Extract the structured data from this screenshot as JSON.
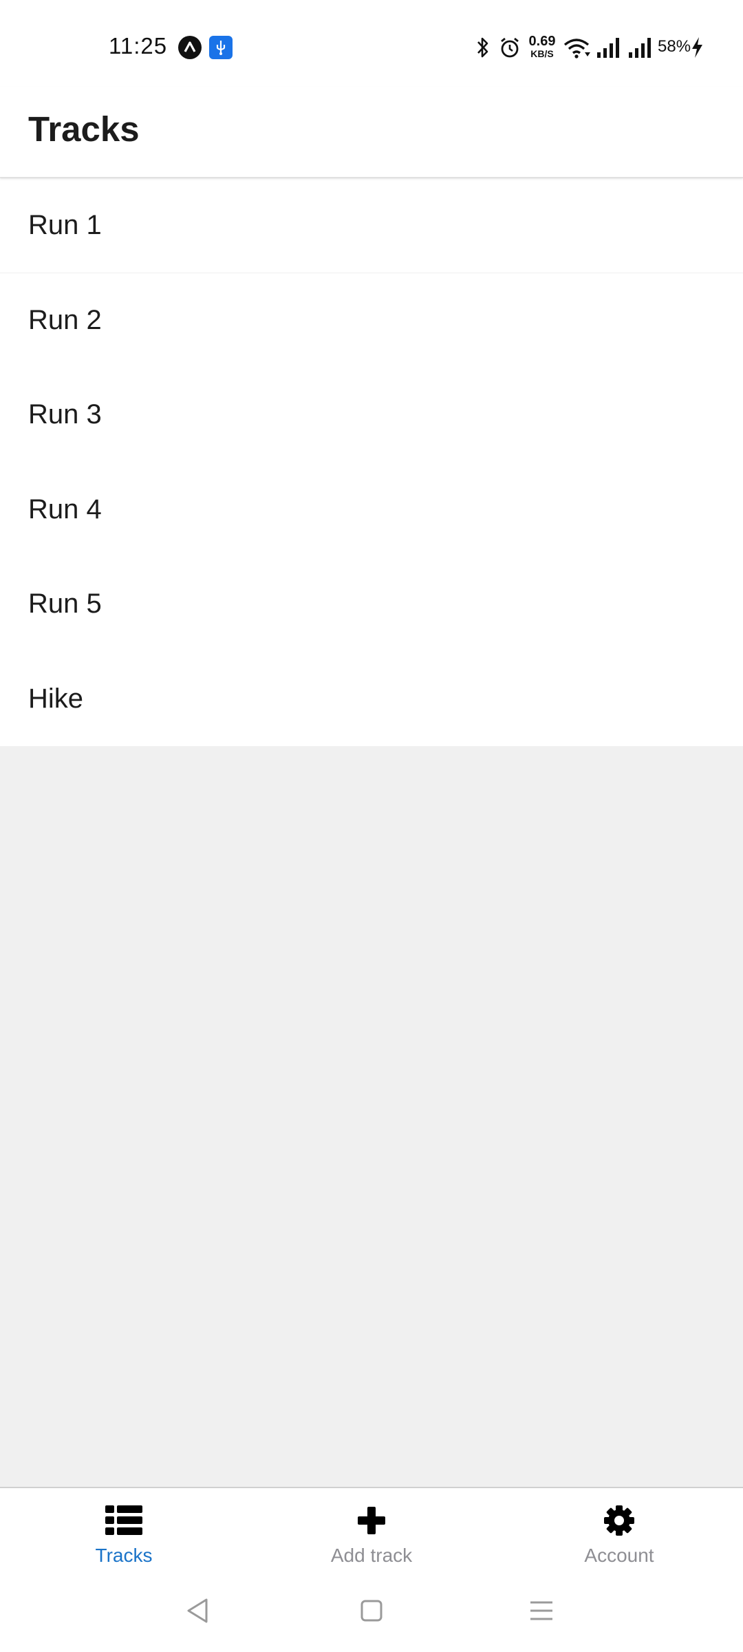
{
  "status_bar": {
    "time": "11:25",
    "net_speed_value": "0.69",
    "net_speed_unit": "KB/S",
    "battery": "58%",
    "icons": [
      "app-notification-icon",
      "usb-debug-icon",
      "bluetooth-icon",
      "alarm-icon",
      "wifi-icon",
      "signal-icon",
      "signal-icon",
      "charging-icon"
    ]
  },
  "header": {
    "title": "Tracks"
  },
  "tracks": [
    {
      "label": "Run 1"
    },
    {
      "label": "Run 2"
    },
    {
      "label": "Run 3"
    },
    {
      "label": "Run 4"
    },
    {
      "label": "Run 5"
    },
    {
      "label": "Hike"
    }
  ],
  "tab_bar": {
    "tracks_label": "Tracks",
    "add_track_label": "Add track",
    "account_label": "Account",
    "active_tab": "Tracks",
    "active_color": "#1a73c8",
    "inactive_color": "#8e8e93"
  },
  "nav_bar": {
    "icons": [
      "back-icon",
      "home-icon",
      "recents-icon"
    ]
  }
}
